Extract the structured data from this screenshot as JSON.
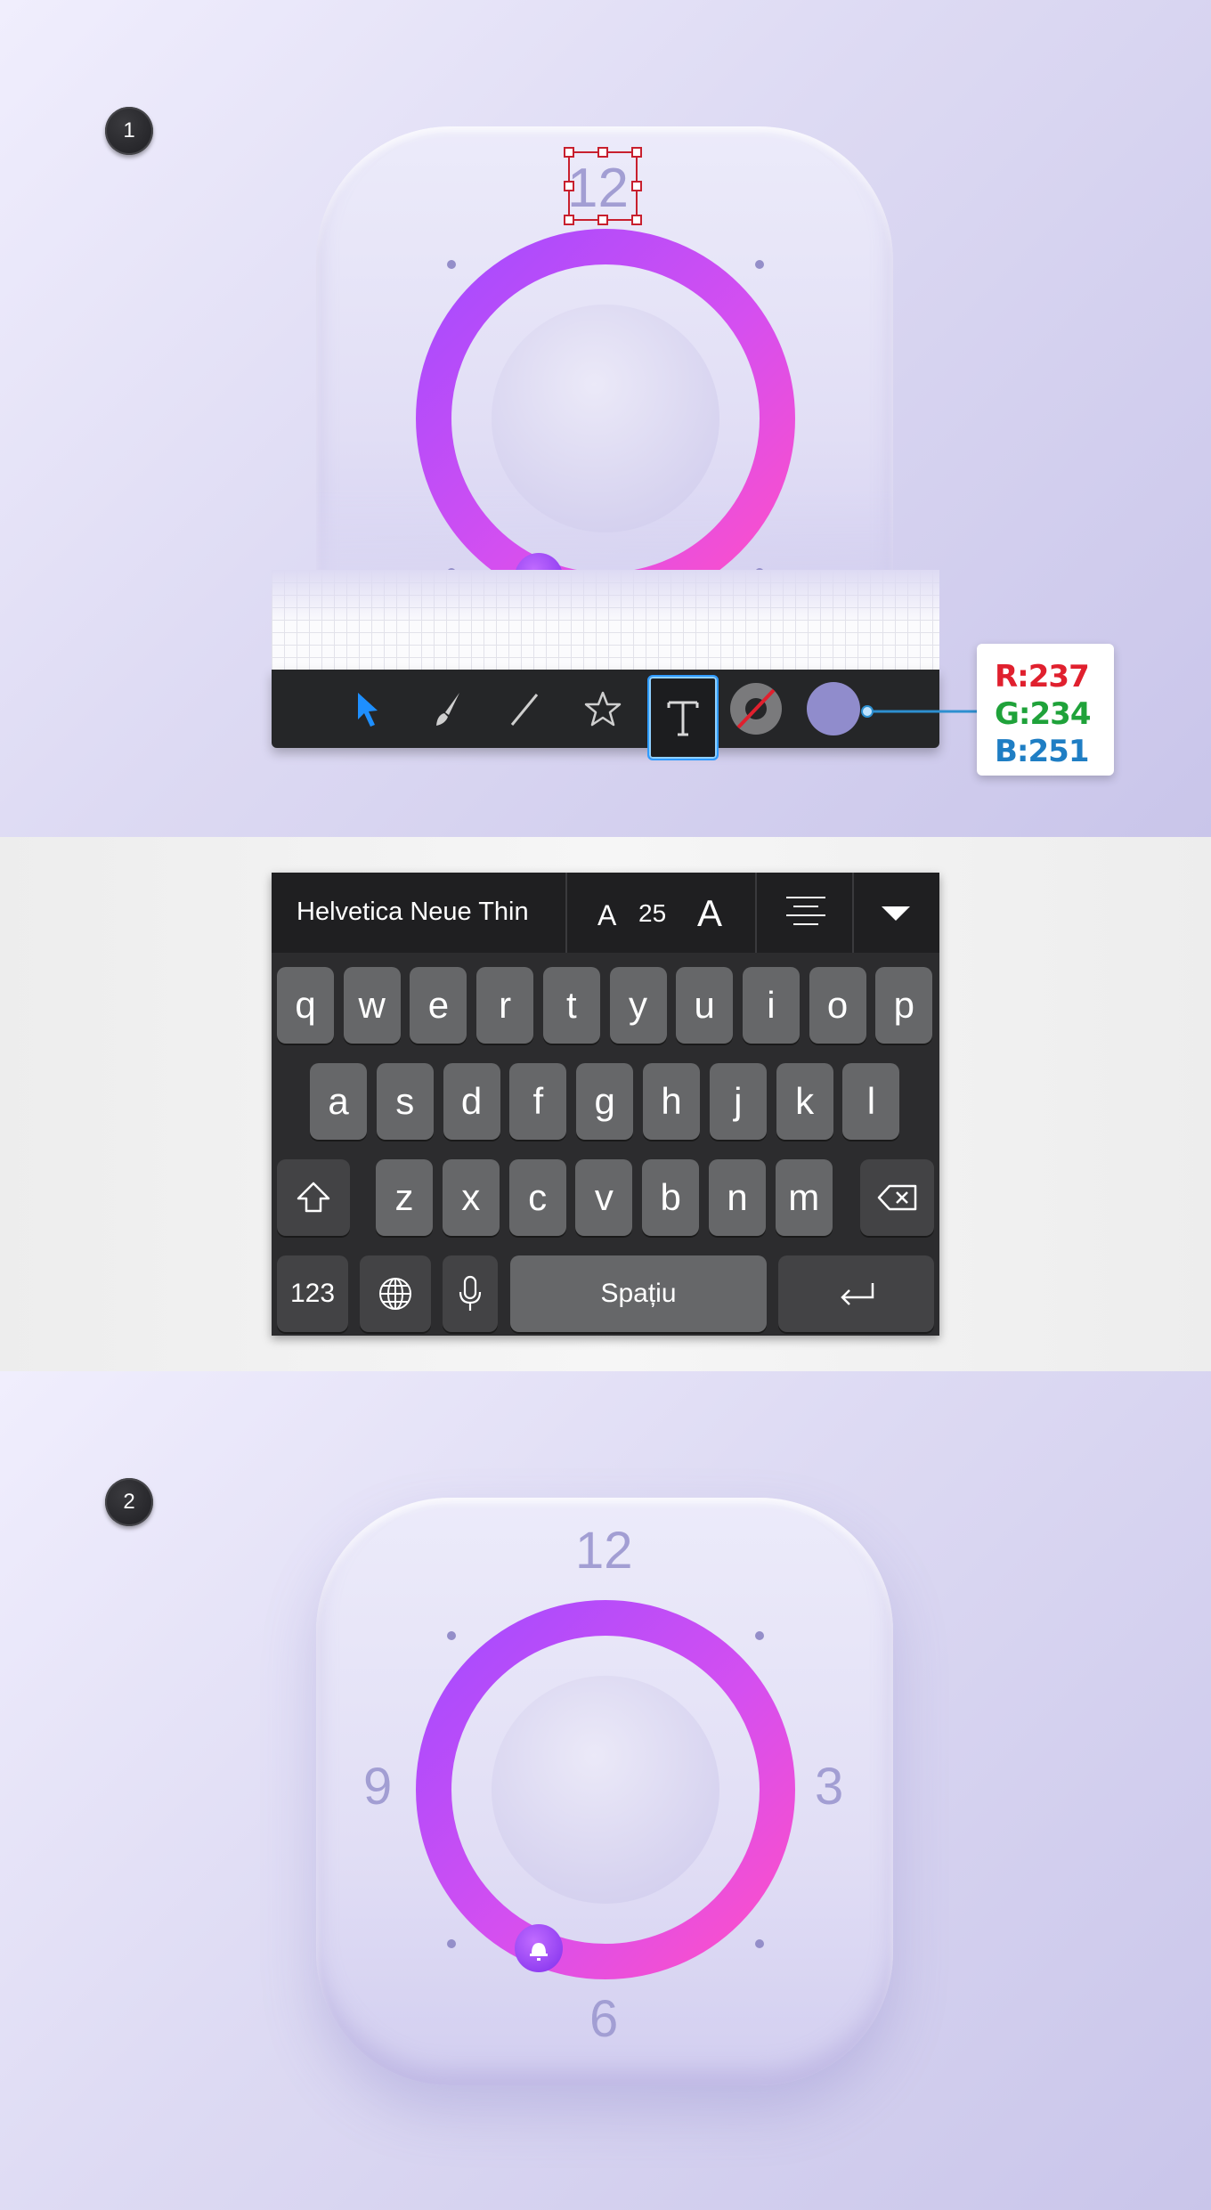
{
  "steps": {
    "step1": "1",
    "step2": "2"
  },
  "step1": {
    "clock_numbers": {
      "top": "12"
    },
    "toolbar": {
      "tools": [
        "select-arrow",
        "brush",
        "line",
        "star",
        "text",
        "stroke",
        "fill"
      ]
    },
    "color_readout": {
      "r": "R:237",
      "g": "G:234",
      "b": "B:251"
    }
  },
  "keyboard": {
    "font_name": "Helvetica Neue Thin",
    "font_size": "25",
    "size_small": "A",
    "size_large": "A",
    "rows": [
      [
        "q",
        "w",
        "e",
        "r",
        "t",
        "y",
        "u",
        "i",
        "o",
        "p"
      ],
      [
        "a",
        "s",
        "d",
        "f",
        "g",
        "h",
        "j",
        "k",
        "l"
      ],
      [
        "z",
        "x",
        "c",
        "v",
        "b",
        "n",
        "m"
      ]
    ],
    "numbers_key": "123",
    "space_key": "Spațiu"
  },
  "step2": {
    "clock_numbers": {
      "top": "12",
      "right": "3",
      "bottom": "6",
      "left": "9"
    }
  },
  "colors": {
    "ring_start": "#a44bff",
    "ring_end": "#ff4fc8",
    "numerals": "#a29ed3",
    "active_tool": "#2f9bff",
    "fill_swatch": "#908ccc",
    "r_color": "#e0202e",
    "g_color": "#1fa23a",
    "b_color": "#1f7ec4"
  }
}
